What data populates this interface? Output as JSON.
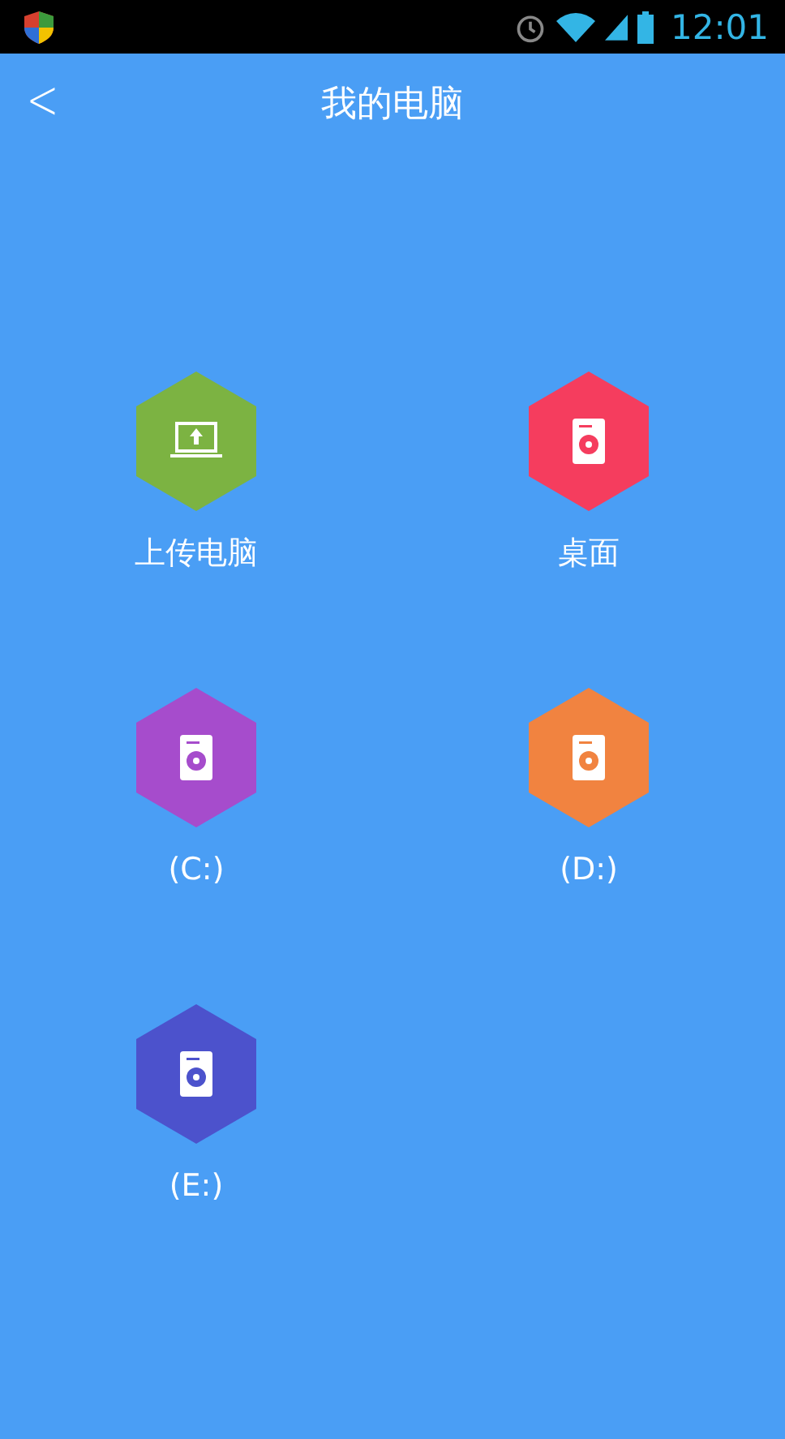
{
  "status_bar": {
    "time": "12:01"
  },
  "header": {
    "back": "<",
    "title": "我的电脑"
  },
  "items": [
    {
      "kind": "upload",
      "label": "上传电脑",
      "color": "#7cb342"
    },
    {
      "kind": "drive",
      "label": "桌面",
      "color": "#f53d5e"
    },
    {
      "kind": "drive",
      "label": "(C:)",
      "color": "#a64ccc"
    },
    {
      "kind": "drive",
      "label": "(D:)",
      "color": "#f18340"
    },
    {
      "kind": "drive",
      "label": "(E:)",
      "color": "#4c52cc"
    }
  ]
}
